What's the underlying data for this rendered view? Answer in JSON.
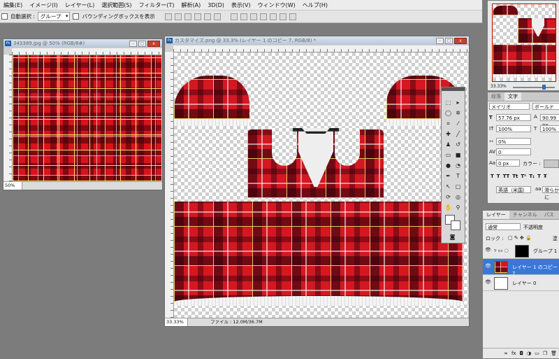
{
  "menu": [
    "編集(E)",
    "イメージ(I)",
    "レイヤー(L)",
    "選択範囲(S)",
    "フィルター(T)",
    "解析(A)",
    "3D(D)",
    "表示(V)",
    "ウィンドウ(W)",
    "ヘルプ(H)"
  ],
  "options": {
    "auto_select_label": "自動選択 :",
    "auto_select_value": "グループ",
    "bbox_label": "バウンディングボックスを表示"
  },
  "small_doc": {
    "title": "343389.jpg @ 50% (RGB/8#)",
    "zoom": "50%"
  },
  "main_doc": {
    "title": "カスタマイズ.png @ 33.3% (レイヤー 1 のコピー 7, RGB/8) *",
    "zoom": "33.33%",
    "file_info": "ファイル : 12.0M/36.7M"
  },
  "navigator": {
    "zoom": "33.33%"
  },
  "character": {
    "tabs": [
      "段落",
      "文字"
    ],
    "font": "メイリオ",
    "style": "ボールド",
    "size": "57.76 px",
    "leading": "90.99 px",
    "vscale": "100%",
    "hscale": "100%",
    "tracking": "0%",
    "kerning": "0",
    "baseline": "0 px",
    "color_label": "カラー :",
    "language": "英語（米国）",
    "aa": "滑らかに"
  },
  "layers": {
    "tabs": [
      "レイヤー",
      "チャンネル",
      "パス"
    ],
    "blend": "通常",
    "opacity_label": "不透明度",
    "lock_label": "ロック :",
    "fill_label": "塗",
    "items": [
      "グループ 1",
      "レイヤー 1 のコピー 7",
      "レイヤー 0"
    ]
  }
}
